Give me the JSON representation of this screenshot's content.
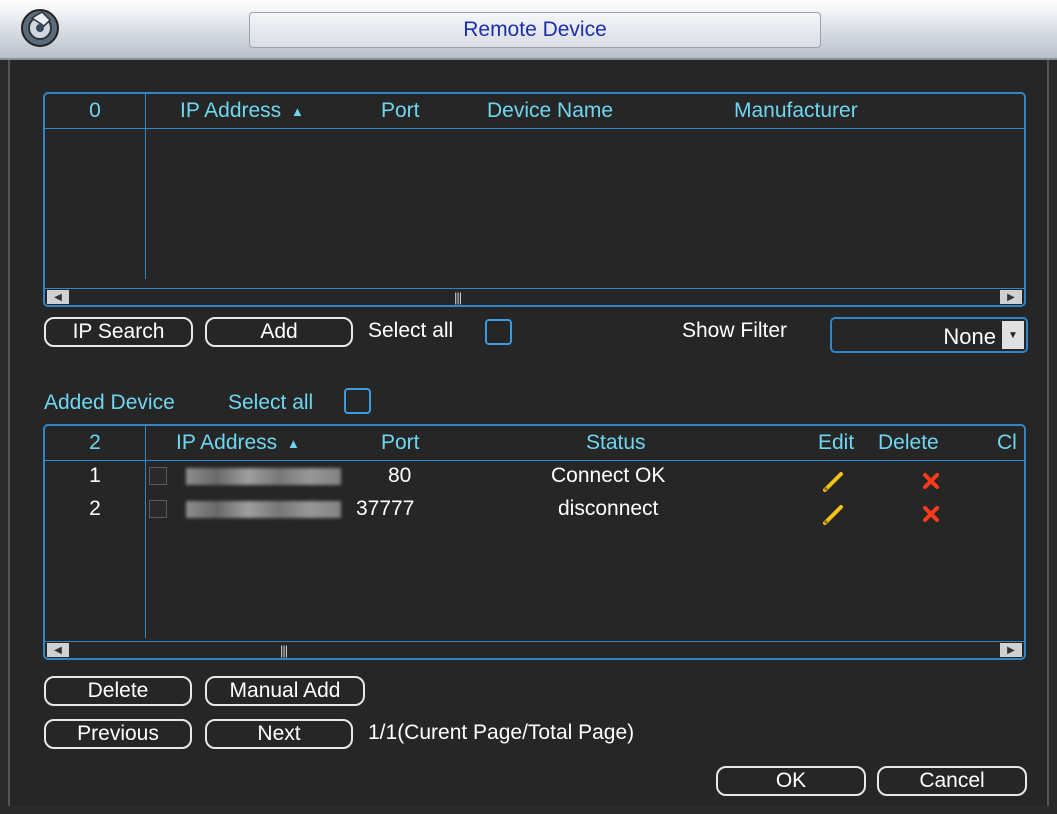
{
  "window": {
    "title": "Remote Device",
    "app_icon": "app-logo-icon"
  },
  "search_table": {
    "count": "0",
    "columns": [
      "IP Address",
      "Port",
      "Device Name",
      "Manufacturer"
    ],
    "sort_indicator": "▲",
    "rows": []
  },
  "search_controls": {
    "ip_search": "IP Search",
    "add": "Add",
    "select_all": "Select all",
    "show_filter": "Show Filter",
    "filter_value": "None"
  },
  "added_device": {
    "title": "Added Device",
    "select_all": "Select all"
  },
  "added_table": {
    "count": "2",
    "columns": [
      "IP Address",
      "Port",
      "Status",
      "Edit",
      "Delete",
      "Cl"
    ],
    "sort_indicator": "▲",
    "rows": [
      {
        "index": "1",
        "port": "80",
        "status": "Connect OK",
        "edit_icon": "pencil-icon",
        "delete_icon": "red-x-icon"
      },
      {
        "index": "2",
        "port": "37777",
        "status": "disconnect",
        "edit_icon": "pencil-icon",
        "delete_icon": "red-x-icon"
      }
    ]
  },
  "added_controls": {
    "delete": "Delete",
    "manual_add": "Manual Add",
    "previous": "Previous",
    "next": "Next",
    "page_info": "1/1(Curent Page/Total Page)"
  },
  "footer": {
    "ok": "OK",
    "cancel": "Cancel"
  },
  "colors": {
    "accent": "#2e86c8",
    "header_text": "#6fd6f0",
    "title_text": "#1a2fb0",
    "delete_red": "#ff3b1a",
    "edit_yellow": "#f2c21b"
  }
}
